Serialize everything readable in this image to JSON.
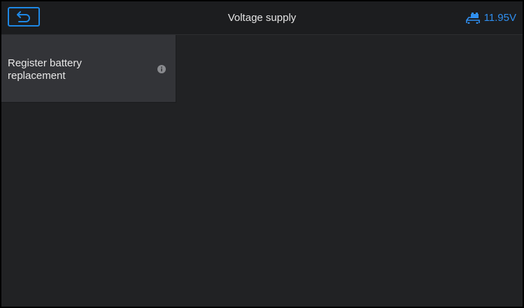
{
  "header": {
    "back_icon": "back-arrow-icon",
    "title": "Voltage supply",
    "battery_icon": "car-battery-icon",
    "voltage": "11.95V"
  },
  "menu": {
    "items": [
      {
        "label": "Register battery replacement",
        "icon": "info-icon"
      }
    ]
  },
  "colors": {
    "accent": "#1e88e5",
    "background": "#212224",
    "topbar": "#1c1d1f",
    "tile": "#333438",
    "text": "#e4e4e4"
  }
}
